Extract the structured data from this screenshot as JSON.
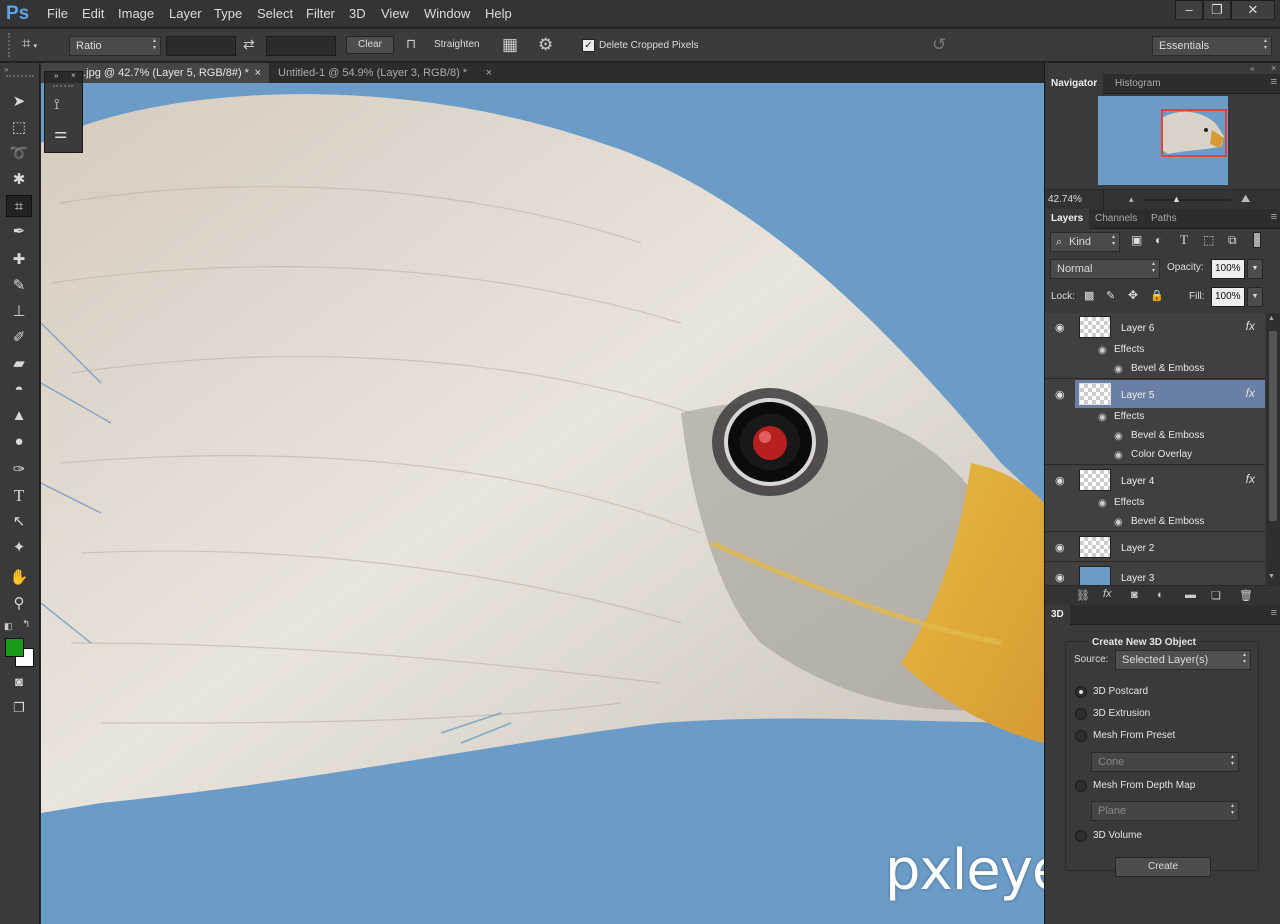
{
  "app": {
    "logo": "Ps"
  },
  "menu": [
    "File",
    "Edit",
    "Image",
    "Layer",
    "Type",
    "Select",
    "Filter",
    "3D",
    "View",
    "Window",
    "Help"
  ],
  "window_controls": {
    "minimize": "–",
    "restore": "❐",
    "close": "✕"
  },
  "options": {
    "ratio": "Ratio",
    "clear": "Clear",
    "straighten": "Straighten",
    "delete_cropped": "Delete Cropped Pixels",
    "delete_cropped_checked": true,
    "workspace": "Essentials"
  },
  "tabs": [
    {
      "label": "...jpg @ 42.7% (Layer 5, RGB/8#) *",
      "close": "×"
    },
    {
      "label": "Untitled-1 @ 54.9% (Layer 3, RGB/8) *",
      "close": "×"
    }
  ],
  "tools": [
    "move-tool",
    "marquee-tool",
    "lasso-tool",
    "magic-wand-tool",
    "crop-tool",
    "eyedropper-tool",
    "healing-brush-tool",
    "brush-tool",
    "clone-stamp-tool",
    "history-brush-tool",
    "eraser-tool",
    "paint-bucket-tool",
    "blur-tool",
    "dodge-tool",
    "pen-tool",
    "type-tool",
    "path-selection-tool",
    "custom-shape-tool",
    "hand-tool",
    "zoom-tool"
  ],
  "colors": {
    "foreground": "#1a9a1a",
    "background": "#ffffff",
    "canvas_bg": "#6b9cc8",
    "selected_layer": "#6a7fa5"
  },
  "navigator": {
    "tabs": [
      "Navigator",
      "Histogram"
    ],
    "zoom": "42.74%"
  },
  "layers_panel": {
    "tabs": [
      "Layers",
      "Channels",
      "Paths"
    ],
    "filter": "Kind",
    "blend_mode": "Normal",
    "opacity_label": "Opacity:",
    "opacity": "100%",
    "lock_label": "Lock:",
    "fill_label": "Fill:",
    "fill": "100%",
    "layers": [
      {
        "name": "Layer 6",
        "fx": "fx",
        "effects_label": "Effects",
        "effects": [
          "Bevel & Emboss"
        ]
      },
      {
        "name": "Layer 5",
        "fx": "fx",
        "effects_label": "Effects",
        "effects": [
          "Bevel & Emboss",
          "Color Overlay"
        ],
        "selected": true
      },
      {
        "name": "Layer 4",
        "fx": "fx",
        "effects_label": "Effects",
        "effects": [
          "Bevel & Emboss"
        ]
      },
      {
        "name": "Layer 2"
      },
      {
        "name": "Layer 3"
      }
    ]
  },
  "panel_3d": {
    "tab": "3D",
    "title": "Create New 3D Object",
    "source_label": "Source:",
    "source": "Selected Layer(s)",
    "options": [
      "3D Postcard",
      "3D Extrusion",
      "Mesh From Preset",
      "Mesh From Depth Map",
      "3D Volume"
    ],
    "selected_option": "3D Postcard",
    "preset": "Cone",
    "depth_map": "Plane",
    "create_button": "Create"
  },
  "watermark": "pxleyes.com"
}
